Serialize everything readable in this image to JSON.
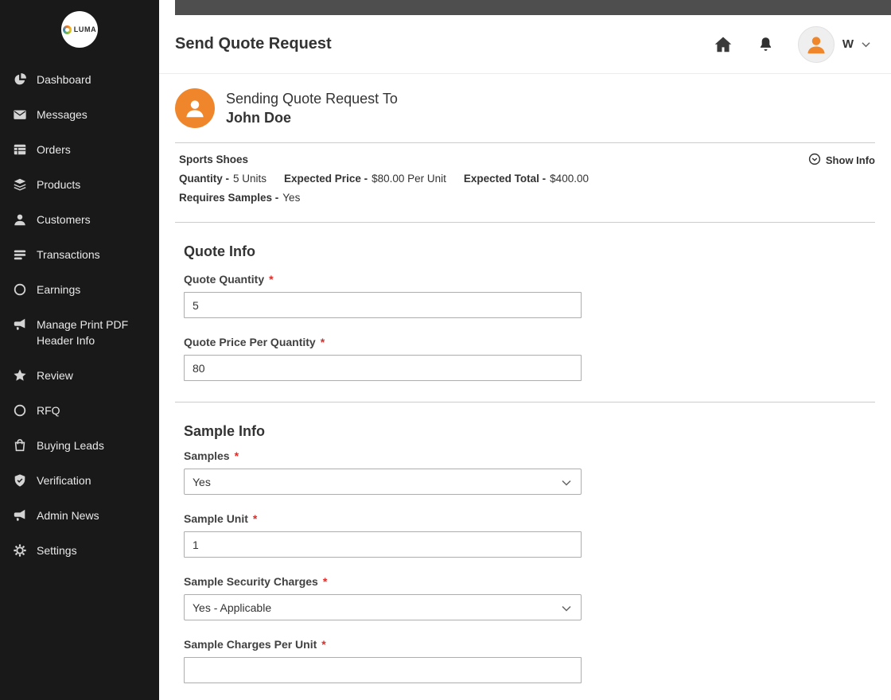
{
  "colors": {
    "accent_orange": "#f0862b",
    "required_red": "#e02b27",
    "sidebar_bg": "#191919"
  },
  "sidebar": {
    "logo": "LUMA",
    "items": [
      {
        "label": "Dashboard"
      },
      {
        "label": "Messages"
      },
      {
        "label": "Orders"
      },
      {
        "label": "Products"
      },
      {
        "label": "Customers"
      },
      {
        "label": "Transactions"
      },
      {
        "label": "Earnings"
      },
      {
        "label": "Manage Print PDF Header Info"
      },
      {
        "label": "Review"
      },
      {
        "label": "RFQ"
      },
      {
        "label": "Buying Leads"
      },
      {
        "label": "Verification"
      },
      {
        "label": "Admin News"
      },
      {
        "label": "Settings"
      }
    ]
  },
  "header": {
    "title": "Send Quote Request",
    "user_initial": "W"
  },
  "recipient": {
    "intro": "Sending Quote Request To",
    "name": "John Doe"
  },
  "product": {
    "name": "Sports Shoes",
    "show_info": "Show Info",
    "quantity_label": "Quantity -",
    "quantity_value": "5 Units",
    "price_label": "Expected Price -",
    "price_value": "$80.00 Per Unit",
    "total_label": "Expected Total -",
    "total_value": "$400.00",
    "samples_label": "Requires Samples -",
    "samples_value": "Yes"
  },
  "quote_info": {
    "heading": "Quote Info",
    "fields": [
      {
        "label": "Quote Quantity",
        "required": "*",
        "value": "5"
      },
      {
        "label": "Quote Price Per Quantity",
        "required": "*",
        "value": "80"
      }
    ]
  },
  "sample_info": {
    "heading": "Sample Info",
    "fields": [
      {
        "label": "Samples",
        "required": "*",
        "value": "Yes"
      },
      {
        "label": "Sample Unit",
        "required": "*",
        "value": "1"
      },
      {
        "label": "Sample Security Charges",
        "required": "*",
        "value": "Yes - Applicable"
      },
      {
        "label": "Sample Charges Per Unit",
        "required": "*",
        "value": ""
      }
    ]
  }
}
